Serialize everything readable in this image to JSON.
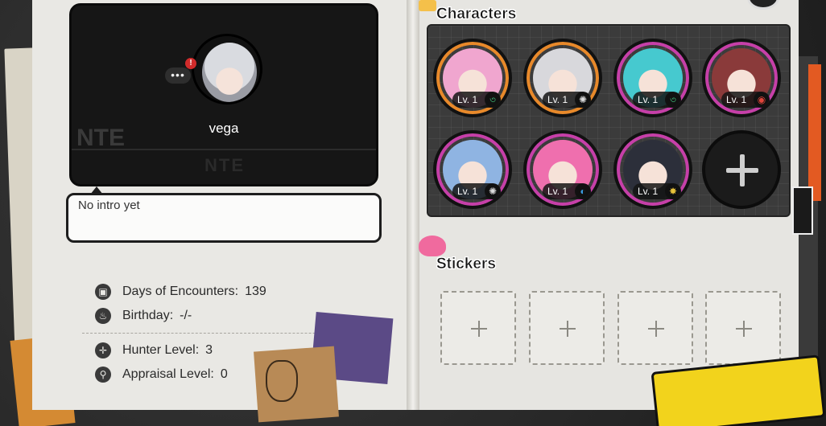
{
  "profile": {
    "username": "vega",
    "more_label": "•••",
    "notif_label": "!",
    "bg_text": "NTE"
  },
  "intro": {
    "text": "No intro yet"
  },
  "stats": {
    "days_label": "Days of Encounters:",
    "days_value": "139",
    "birthday_label": "Birthday:",
    "birthday_value": "-/-",
    "hunter_label": "Hunter Level:",
    "hunter_value": "3",
    "appraisal_label": "Appraisal Level:",
    "appraisal_value": "0"
  },
  "characters": {
    "title": "Characters",
    "items": [
      {
        "level": "Lv. 1",
        "ring": "#e8892a",
        "portrait": "#f0a6cf",
        "element_icon": "wind-icon",
        "element_glyph": "৩",
        "element_color": "#3fc07a"
      },
      {
        "level": "Lv. 1",
        "ring": "#e8892a",
        "portrait": "#d8d8dc",
        "element_icon": "light-icon",
        "element_glyph": "✺",
        "element_color": "#dcdcdc"
      },
      {
        "level": "Lv. 1",
        "ring": "#c63fa8",
        "portrait": "#46c9cf",
        "element_icon": "wind-icon",
        "element_glyph": "৩",
        "element_color": "#3fc07a"
      },
      {
        "level": "Lv. 1",
        "ring": "#c63fa8",
        "portrait": "#8a3a3a",
        "element_icon": "fire-icon",
        "element_glyph": "◉",
        "element_color": "#e0443a"
      },
      {
        "level": "Lv. 1",
        "ring": "#c63fa8",
        "portrait": "#8fb4e2",
        "element_icon": "light-icon",
        "element_glyph": "✺",
        "element_color": "#dcdcdc"
      },
      {
        "level": "Lv. 1",
        "ring": "#c63fa8",
        "portrait": "#ef6fae",
        "element_icon": "water-icon",
        "element_glyph": "◐",
        "element_color": "#3a9be0"
      },
      {
        "level": "Lv. 1",
        "ring": "#c63fa8",
        "portrait": "#2c2f3a",
        "element_icon": "spark-icon",
        "element_glyph": "✸",
        "element_color": "#e8c23a"
      }
    ]
  },
  "stickers": {
    "title": "Stickers"
  },
  "colors": {
    "accent_orange": "#e8892a",
    "accent_magenta": "#c63fa8",
    "card_bg": "#161616"
  }
}
